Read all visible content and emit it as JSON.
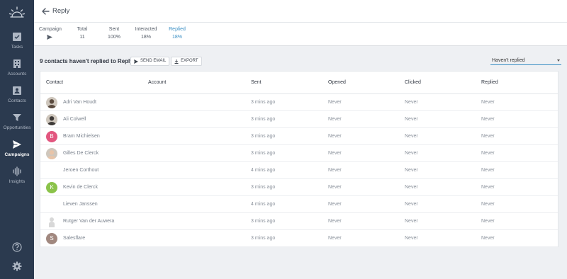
{
  "sidebar": {
    "items": [
      {
        "label": "Tasks",
        "icon": "tasks-icon"
      },
      {
        "label": "Accounts",
        "icon": "accounts-icon"
      },
      {
        "label": "Contacts",
        "icon": "contacts-icon"
      },
      {
        "label": "Opportunities",
        "icon": "funnel-icon"
      },
      {
        "label": "Campaigns",
        "icon": "send-icon",
        "active": true
      },
      {
        "label": "Insights",
        "icon": "waveform-icon"
      }
    ],
    "bottom": [
      {
        "icon": "help-icon"
      },
      {
        "icon": "gear-icon"
      }
    ]
  },
  "header": {
    "title": "Reply"
  },
  "stats": [
    {
      "label": "Campaign",
      "value": ""
    },
    {
      "label": "Total",
      "value": "11"
    },
    {
      "label": "Sent",
      "value": "100%"
    },
    {
      "label": "Interacted",
      "value": "18%"
    },
    {
      "label": "Replied",
      "value": "18%",
      "active": true
    }
  ],
  "toolbar": {
    "title": "9 contacts haven't replied to Reply",
    "send_email": "SEND EMAIL",
    "export": "EXPORT",
    "filter": "Haven't replied"
  },
  "table": {
    "columns": [
      "Contact",
      "Account",
      "Sent",
      "Opened",
      "Clicked",
      "Replied"
    ],
    "rows": [
      {
        "name": "Adri Van Houdt",
        "account": "",
        "sent": "3 mins ago",
        "opened": "Never",
        "clicked": "Never",
        "replied": "Never",
        "avatar": {
          "type": "photo",
          "color": "#5a4a3e"
        }
      },
      {
        "name": "Ali Colwell",
        "account": "",
        "sent": "3 mins ago",
        "opened": "Never",
        "clicked": "Never",
        "replied": "Never",
        "avatar": {
          "type": "photo",
          "color": "#3e3a38"
        }
      },
      {
        "name": "Bram Michielsen",
        "account": "",
        "sent": "3 mins ago",
        "opened": "Never",
        "clicked": "Never",
        "replied": "Never",
        "avatar": {
          "type": "letter",
          "letter": "B",
          "color": "#e2567f"
        }
      },
      {
        "name": "Gilles De Clerck",
        "account": "",
        "sent": "3 mins ago",
        "opened": "Never",
        "clicked": "Never",
        "replied": "Never",
        "avatar": {
          "type": "photo",
          "color": "#e8c4a8"
        }
      },
      {
        "name": "Jeroen Corthout",
        "account": "",
        "sent": "4 mins ago",
        "opened": "Never",
        "clicked": "Never",
        "replied": "Never",
        "avatar": {
          "type": "none"
        }
      },
      {
        "name": "Kevin de Clerck",
        "account": "",
        "sent": "3 mins ago",
        "opened": "Never",
        "clicked": "Never",
        "replied": "Never",
        "avatar": {
          "type": "letter",
          "letter": "K",
          "color": "#8bc34a"
        }
      },
      {
        "name": "Lieven Janssen",
        "account": "",
        "sent": "4 mins ago",
        "opened": "Never",
        "clicked": "Never",
        "replied": "Never",
        "avatar": {
          "type": "none"
        }
      },
      {
        "name": "Rutger Van der Auwera",
        "account": "",
        "sent": "3 mins ago",
        "opened": "Never",
        "clicked": "Never",
        "replied": "Never",
        "avatar": {
          "type": "placeholder",
          "color": "#d8d8d8"
        }
      },
      {
        "name": "Salesflare",
        "account": "",
        "sent": "3 mins ago",
        "opened": "Never",
        "clicked": "Never",
        "replied": "Never",
        "avatar": {
          "type": "letter",
          "letter": "S",
          "color": "#a1887f"
        }
      }
    ]
  },
  "colors": {
    "sidebar": "#2b3a4f",
    "accent": "#3a8fc4",
    "background": "#eef0f3"
  }
}
